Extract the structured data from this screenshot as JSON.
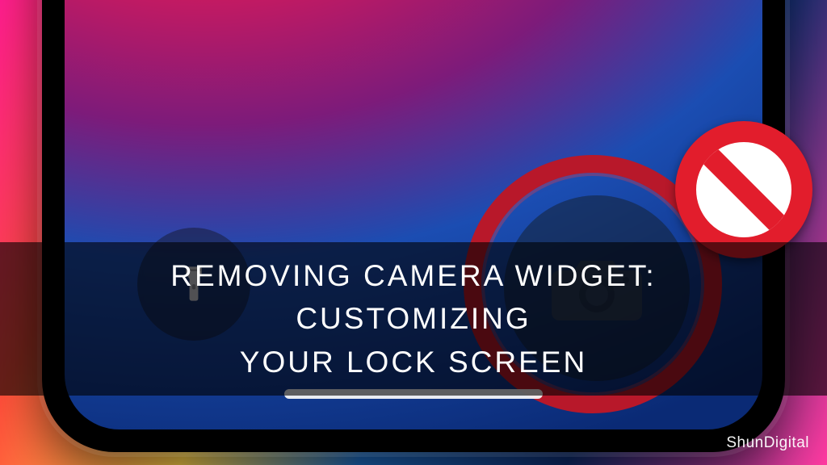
{
  "caption": {
    "line1": "REMOVING CAMERA WIDGET: CUSTOMIZING",
    "line2": "YOUR LOCK SCREEN"
  },
  "watermark": "ShunDigital",
  "icons": {
    "flashlight": "flashlight-icon",
    "camera": "camera-icon",
    "prohibit": "prohibit-icon"
  },
  "colors": {
    "ring": "#b8182a",
    "prohibit": "#e21d2c",
    "overlay": "rgba(0,0,0,0.60)"
  }
}
